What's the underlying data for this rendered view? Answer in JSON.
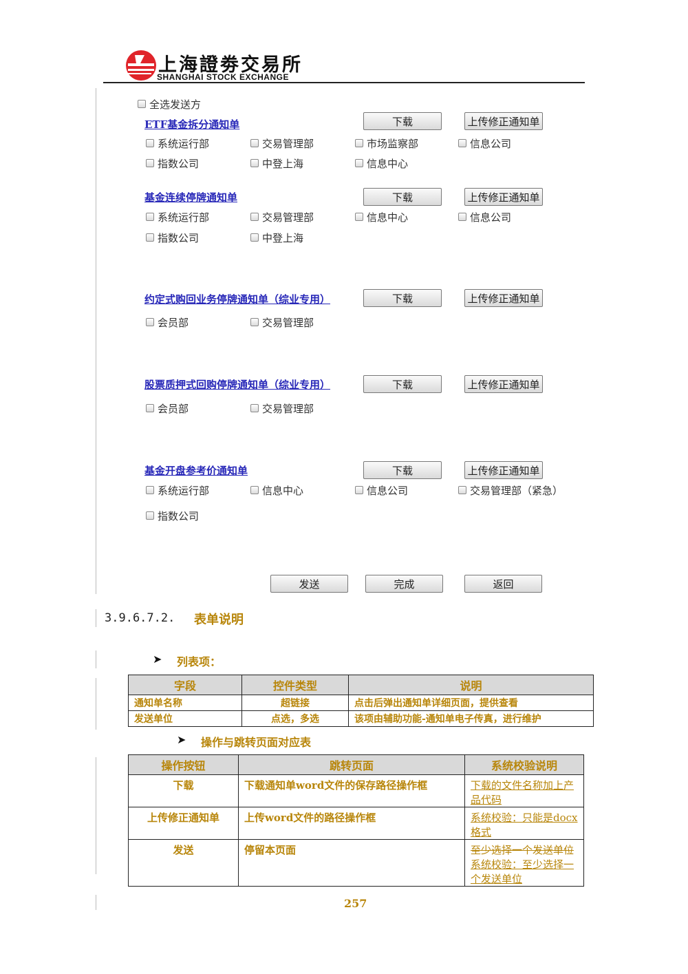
{
  "header": {
    "logo_cn": "上海證劵交易所",
    "logo_en": "SHANGHAI  STOCK  EXCHANGE",
    "colors": {
      "logo_red": "#e0242a",
      "link_blue": "#2727b8",
      "accent_gold": "#b8860b"
    }
  },
  "select_all": {
    "label": "全选发送方"
  },
  "buttons": {
    "download": "下载",
    "upload": "上传修正通知单"
  },
  "groups": [
    {
      "title": "ETF基金拆分通知单",
      "options": [
        "系统运行部",
        "交易管理部",
        "市场监察部",
        "信息公司",
        "指数公司",
        "中登上海",
        "信息中心"
      ]
    },
    {
      "title": "基金连续停牌通知单",
      "options": [
        "系统运行部",
        "交易管理部",
        "信息中心",
        "信息公司",
        "指数公司",
        "中登上海"
      ]
    },
    {
      "title": "约定式购回业务停牌通知单（综业专用）",
      "options": [
        "会员部",
        "交易管理部"
      ]
    },
    {
      "title": "股票质押式回购停牌通知单（综业专用）",
      "options": [
        "会员部",
        "交易管理部"
      ]
    },
    {
      "title": "基金开盘参考价通知单",
      "options": [
        "系统运行部",
        "信息中心",
        "信息公司",
        "交易管理部（紧急）",
        "指数公司"
      ]
    }
  ],
  "footer_buttons": {
    "send": "发送",
    "done": "完成",
    "back": "返回"
  },
  "section": {
    "number": "3.9.6.7.2.",
    "title": "表单说明"
  },
  "list_heading": "列表项：",
  "list_table": {
    "headers": [
      "字段",
      "控件类型",
      "说明"
    ],
    "rows": [
      [
        "通知单名称",
        "超链接",
        "点击后弹出通知单详细页面，提供查看"
      ],
      [
        "发送单位",
        "点选，多选",
        "该项由辅助功能-通知单电子传真，进行维护"
      ]
    ]
  },
  "ops_heading": "操作与跳转页面对应表",
  "ops_table": {
    "headers": [
      "操作按钮",
      "跳转页面",
      "系统校验说明"
    ],
    "rows": [
      {
        "button": "下载",
        "page": "下载通知单word文件的保存路径操作框",
        "check": "下载的文件名称加上产品代码"
      },
      {
        "button": "上传修正通知单",
        "page": "上传word文件的路径操作框",
        "check": "系统校验：只能是docx格式"
      },
      {
        "button": "发送",
        "page": "停留本页面",
        "check_struck": "至少选择一个发送单位",
        "check": "系统校验：至少选择一个发送单位"
      }
    ]
  },
  "page_number": "257"
}
